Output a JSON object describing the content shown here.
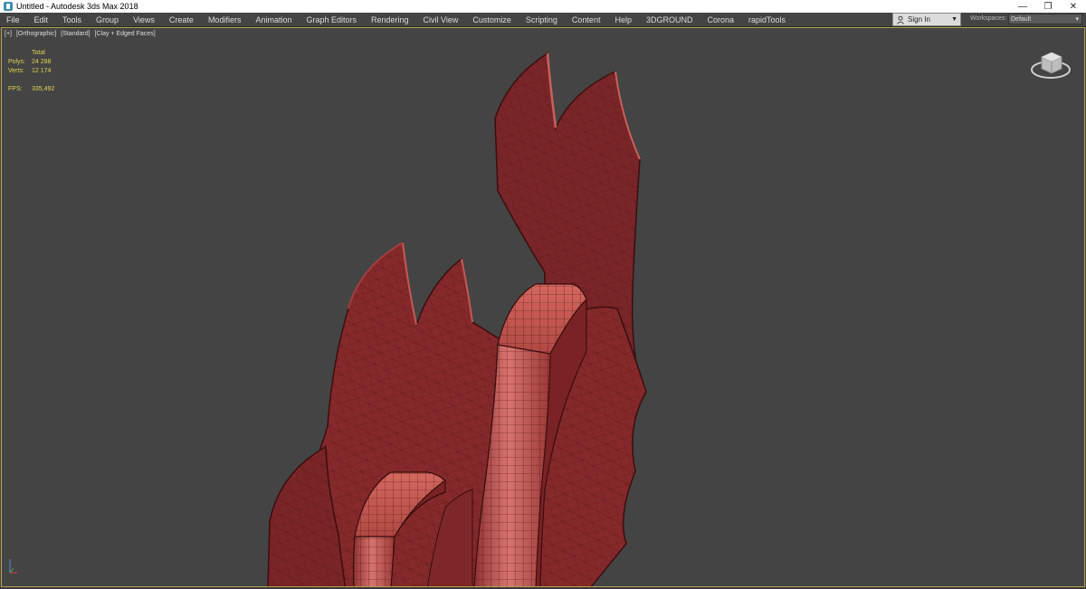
{
  "window": {
    "title": "Untitled - Autodesk 3ds Max 2018",
    "controls": [
      "minimize-icon",
      "restore-icon",
      "close-icon"
    ]
  },
  "menu": {
    "items": [
      "File",
      "Edit",
      "Tools",
      "Group",
      "Views",
      "Create",
      "Modifiers",
      "Animation",
      "Graph Editors",
      "Rendering",
      "Civil View",
      "Customize",
      "Scripting",
      "Content",
      "Help",
      "3DGROUND",
      "Corona",
      "rapidTools"
    ]
  },
  "account": {
    "sign_in_label": "Sign In",
    "workspaces_label": "Workspaces:",
    "workspace_value": "Default"
  },
  "viewport": {
    "label_parts": [
      "[+]",
      "[Orthographic]",
      "[Standard]",
      "[Clay + Edged Faces]"
    ],
    "stats": {
      "header": "Total",
      "polys_label": "Polys:",
      "polys_value": "24 288",
      "verts_label": "Verts:",
      "verts_value": "12 174",
      "fps_label": "FPS:",
      "fps_value": "335,492"
    }
  },
  "colors": {
    "viewport_bg": "#444444",
    "viewport_border": "#b4a14a",
    "stats_text": "#e4d250",
    "clay_dark": "#6e2326",
    "clay_mid": "#8c2f31",
    "clay_light": "#c9605b"
  }
}
